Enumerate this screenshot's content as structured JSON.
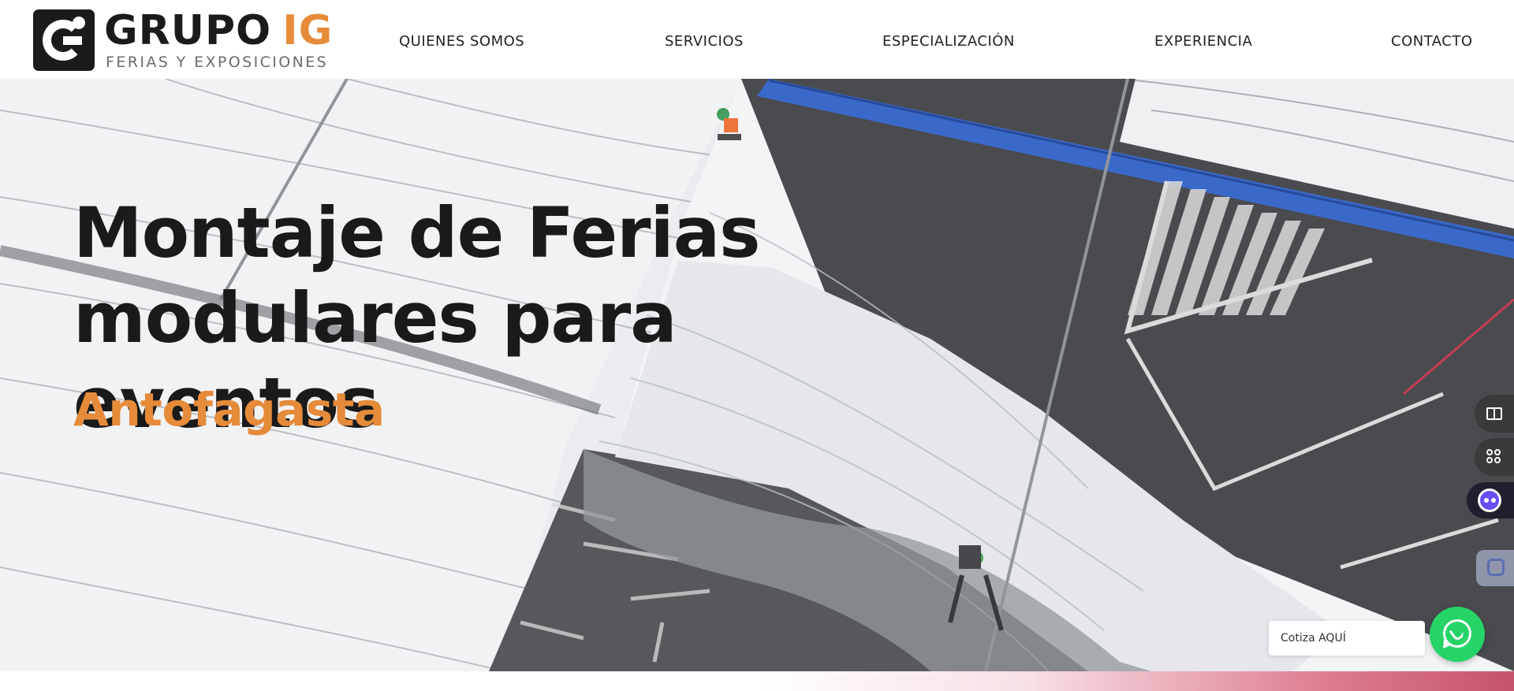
{
  "brand": {
    "word1": "GRUPO",
    "word2": "IG",
    "tagline": "FERIAS Y EXPOSICIONES",
    "accent_color": "#e58b3a",
    "dark_color": "#1b1b1b"
  },
  "nav": {
    "items": [
      {
        "label": "QUIENES SOMOS"
      },
      {
        "label": "SERVICIOS"
      },
      {
        "label": "ESPECIALIZACIÓN"
      },
      {
        "label": "EXPERIENCIA"
      },
      {
        "label": "CONTACTO"
      }
    ]
  },
  "hero": {
    "title_line1": "Montaje de Ferias",
    "title_line2": "modulares para eventos",
    "subtitle": "Antofagasta",
    "background": "aerial-tent-installation-photo"
  },
  "widgets": {
    "side_icons": [
      "book-icon",
      "grid-icon",
      "ai-assistant-icon",
      "cursor-icon"
    ],
    "cotiza_label": "Cotiza AQUÍ",
    "whatsapp_icon": "whatsapp-icon",
    "whatsapp_color": "#25d366"
  }
}
